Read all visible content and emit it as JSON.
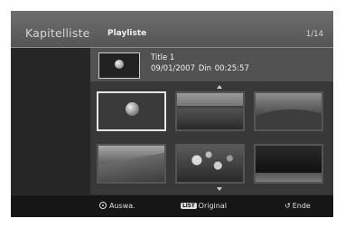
{
  "header": {
    "title": "Kapitelliste",
    "subtitle": "Playliste",
    "page_counter": "1/14"
  },
  "info": {
    "title": "Title 1",
    "meta": "09/01/2007  Din  00:25:57"
  },
  "thumbnails": [
    {
      "label": "chapter-1",
      "selected": true
    },
    {
      "label": "chapter-2",
      "selected": false
    },
    {
      "label": "chapter-3",
      "selected": false
    },
    {
      "label": "chapter-4",
      "selected": false
    },
    {
      "label": "chapter-5",
      "selected": false
    },
    {
      "label": "chapter-6",
      "selected": false
    }
  ],
  "footer": {
    "select_label": "Auswa.",
    "list_badge": "LIST",
    "original_label": "Original",
    "end_label": "Ende"
  },
  "icons": {
    "ok": "ok-button-icon",
    "list": "list-button-icon",
    "return": "return-icon",
    "up": "scroll-up-icon",
    "down": "scroll-down-icon"
  }
}
